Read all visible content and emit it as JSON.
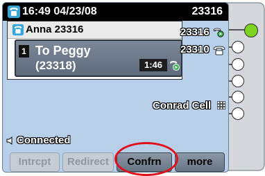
{
  "header": {
    "datetime": "16:49 04/23/08",
    "extension": "23316"
  },
  "call_window": {
    "caller": "Anna 23316",
    "active_call": {
      "index": "1",
      "to": "To Peggy",
      "number": "(23318)",
      "duration": "1:46"
    }
  },
  "lines": [
    {
      "label": "23316",
      "icon": "call-active-icon",
      "led": "green"
    },
    {
      "label": "23310",
      "icon": "phone-icon",
      "led": "off"
    },
    {
      "label": "",
      "led": "off"
    },
    {
      "label": "",
      "led": "off"
    },
    {
      "label": "Conrad Cell",
      "icon": "speed-dial-icon",
      "led": "off"
    },
    {
      "label": "",
      "led": "off"
    }
  ],
  "status": {
    "text": "Connected",
    "icon": "speaker-icon"
  },
  "softkeys": [
    {
      "label": "Intrcpt",
      "enabled": false
    },
    {
      "label": "Redirect",
      "enabled": false
    },
    {
      "label": "Confrn",
      "enabled": true,
      "highlighted": true
    },
    {
      "label": "more",
      "enabled": true
    }
  ],
  "colors": {
    "screen_bg": "#b7cfe9",
    "header_bg": "#000000",
    "led_active": "#7ed321",
    "highlight": "#e0101a"
  }
}
